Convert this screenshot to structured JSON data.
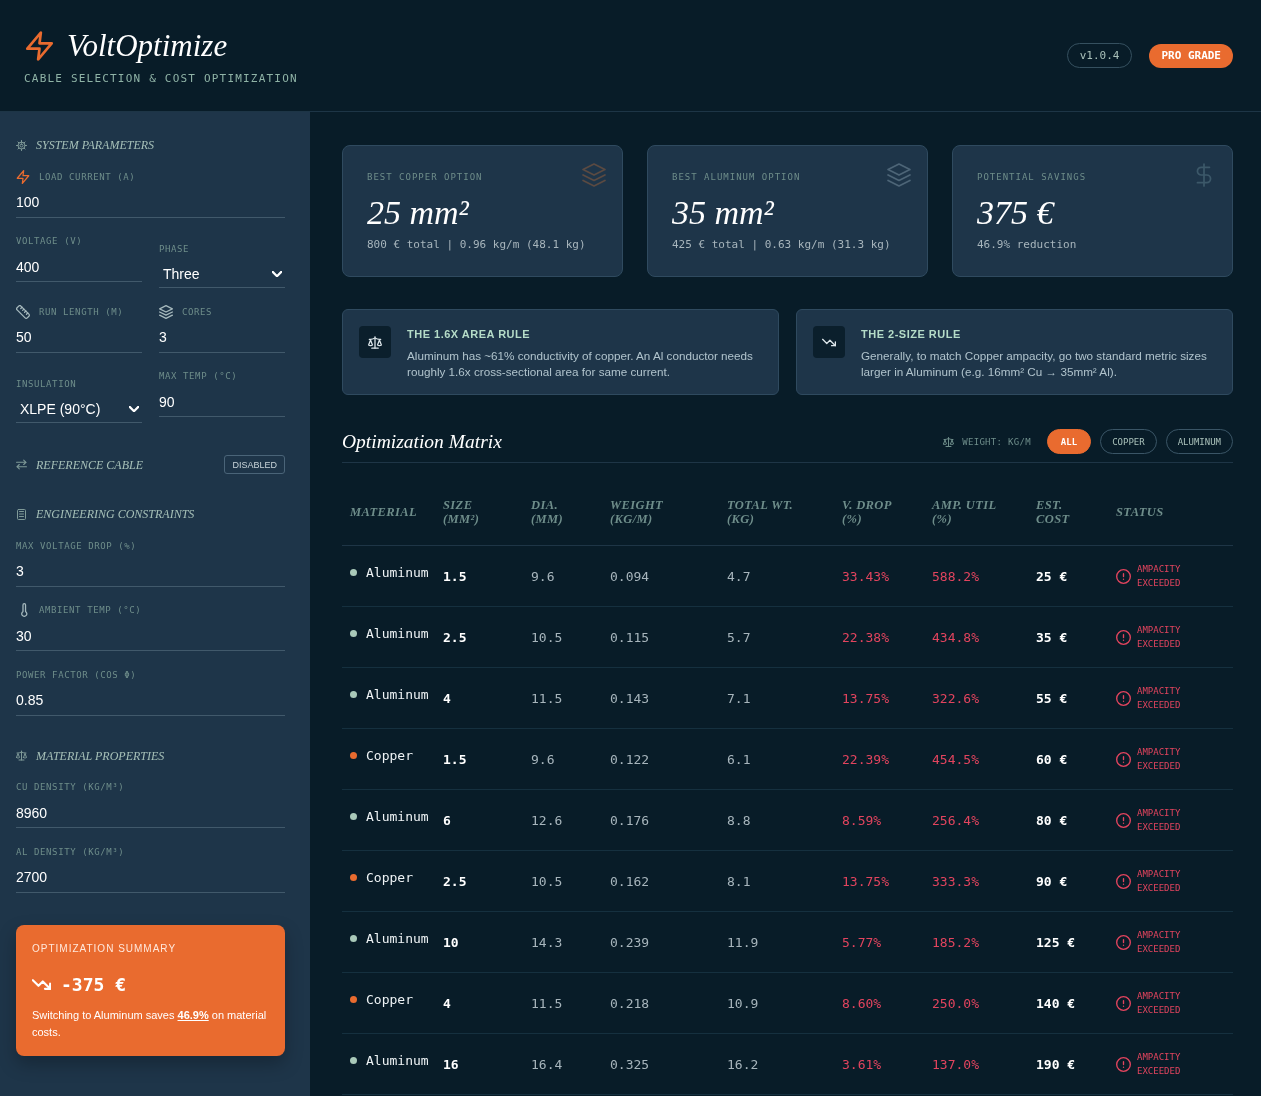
{
  "header": {
    "title": "VoltOptimize",
    "subtitle": "CABLE SELECTION & COST OPTIMIZATION",
    "version": "v1.0.4",
    "badge": "PRO GRADE"
  },
  "sidebar": {
    "sections": [
      {
        "kind": "fields",
        "title": "SYSTEM PARAMETERS",
        "rows": [
          [
            {
              "kind": "input",
              "label": "LOAD CURRENT (A)",
              "value": "100"
            }
          ],
          [
            {
              "kind": "input",
              "label": "VOLTAGE (V)",
              "value": "400"
            },
            {
              "kind": "select",
              "label": "PHASE",
              "value": "Three"
            }
          ],
          [
            {
              "kind": "input",
              "label": "RUN LENGTH (M)",
              "value": "50"
            },
            {
              "kind": "input",
              "label": "CORES",
              "value": "3"
            }
          ],
          [
            {
              "kind": "select",
              "label": "INSULATION",
              "value": "XLPE (90°C)"
            },
            {
              "kind": "input",
              "label": "MAX TEMP (°C)",
              "value": "90"
            }
          ]
        ]
      },
      {
        "kind": "toggle",
        "title": "REFERENCE CABLE",
        "badge": "DISABLED"
      },
      {
        "kind": "fields",
        "title": "ENGINEERING CONSTRAINTS",
        "rows": [
          [
            {
              "kind": "input",
              "label": "MAX VOLTAGE DROP (%)",
              "value": "3"
            }
          ],
          [
            {
              "kind": "input",
              "label": "AMBIENT TEMP (°C)",
              "value": "30"
            }
          ],
          [
            {
              "kind": "input",
              "label": "POWER FACTOR (COS Φ)",
              "value": "0.85"
            }
          ]
        ]
      },
      {
        "kind": "fields",
        "title": "MATERIAL PROPERTIES",
        "rows": [
          [
            {
              "kind": "input",
              "label": "CU DENSITY (KG/M³)",
              "value": "8960"
            }
          ],
          [
            {
              "kind": "input",
              "label": "AL DENSITY (KG/M³)",
              "value": "2700"
            }
          ]
        ]
      }
    ],
    "summary": {
      "label": "OPTIMIZATION SUMMARY",
      "value": "-375 €",
      "text": "Switching to Aluminum saves **46.9%** on material costs."
    }
  },
  "stats": [
    {
      "label": "BEST COPPER OPTION",
      "value": "25 mm²",
      "detail": "800 € total | 0.96 kg/m (48.1 kg)",
      "color": "#5a4a42"
    },
    {
      "label": "BEST ALUMINUM OPTION",
      "value": "35 mm²",
      "detail": "425 € total | 0.63 kg/m (31.3 kg)",
      "color": "#4d6577"
    },
    {
      "label": "POTENTIAL SAVINGS",
      "value": "375 €",
      "detail": "46.9% reduction",
      "color": "#3c5869"
    }
  ],
  "rules": [
    {
      "title": "THE 1.6X AREA RULE",
      "text": "Aluminum has ~61% conductivity of copper. An Al conductor needs roughly 1.6x cross-sectional area for same current."
    },
    {
      "title": "THE 2-SIZE RULE",
      "text": "Generally, to match Copper ampacity, go two standard metric sizes larger in Aluminum (e.g. 16mm² Cu → 35mm² Al)."
    }
  ],
  "matrix": {
    "title": "Optimization Matrix",
    "unit_label": "WEIGHT: KG/M",
    "filters": [
      {
        "label": "ALL",
        "selected": true
      },
      {
        "label": "COPPER",
        "selected": false
      },
      {
        "label": "ALUMINUM",
        "selected": false
      }
    ],
    "columns": [
      "MATERIAL",
      "SIZE (MM²)",
      "DIA. (MM)",
      "WEIGHT (KG/M)",
      "TOTAL WT. (KG)",
      "V. DROP (%)",
      "AMP. UTIL (%)",
      "EST. COST",
      "STATUS"
    ],
    "rows": [
      {
        "material": "Aluminum",
        "color": "#a9c9b9",
        "size": "1.5",
        "diameter": "9.6",
        "weight": "0.094",
        "total_weight": "4.7",
        "voltage_drop": "33.43%",
        "amp_util": "588.2%",
        "cost": "25 €",
        "over_limit": true,
        "status": {
          "kind": "error",
          "text": "AMPACITY EXCEEDED"
        }
      },
      {
        "material": "Aluminum",
        "color": "#a9c9b9",
        "size": "2.5",
        "diameter": "10.5",
        "weight": "0.115",
        "total_weight": "5.7",
        "voltage_drop": "22.38%",
        "amp_util": "434.8%",
        "cost": "35 €",
        "over_limit": true,
        "status": {
          "kind": "error",
          "text": "AMPACITY EXCEEDED"
        }
      },
      {
        "material": "Aluminum",
        "color": "#a9c9b9",
        "size": "4",
        "diameter": "11.5",
        "weight": "0.143",
        "total_weight": "7.1",
        "voltage_drop": "13.75%",
        "amp_util": "322.6%",
        "cost": "55 €",
        "over_limit": true,
        "status": {
          "kind": "error",
          "text": "AMPACITY EXCEEDED"
        }
      },
      {
        "material": "Copper",
        "color": "#e96b2f",
        "size": "1.5",
        "diameter": "9.6",
        "weight": "0.122",
        "total_weight": "6.1",
        "voltage_drop": "22.39%",
        "amp_util": "454.5%",
        "cost": "60 €",
        "over_limit": true,
        "status": {
          "kind": "error",
          "text": "AMPACITY EXCEEDED"
        }
      },
      {
        "material": "Aluminum",
        "color": "#a9c9b9",
        "size": "6",
        "diameter": "12.6",
        "weight": "0.176",
        "total_weight": "8.8",
        "voltage_drop": "8.59%",
        "amp_util": "256.4%",
        "cost": "80 €",
        "over_limit": true,
        "status": {
          "kind": "error",
          "text": "AMPACITY EXCEEDED"
        }
      },
      {
        "material": "Copper",
        "color": "#e96b2f",
        "size": "2.5",
        "diameter": "10.5",
        "weight": "0.162",
        "total_weight": "8.1",
        "voltage_drop": "13.75%",
        "amp_util": "333.3%",
        "cost": "90 €",
        "over_limit": true,
        "status": {
          "kind": "error",
          "text": "AMPACITY EXCEEDED"
        }
      },
      {
        "material": "Aluminum",
        "color": "#a9c9b9",
        "size": "10",
        "diameter": "14.3",
        "weight": "0.239",
        "total_weight": "11.9",
        "voltage_drop": "5.77%",
        "amp_util": "185.2%",
        "cost": "125 €",
        "over_limit": true,
        "status": {
          "kind": "error",
          "text": "AMPACITY EXCEEDED"
        }
      },
      {
        "material": "Copper",
        "color": "#e96b2f",
        "size": "4",
        "diameter": "11.5",
        "weight": "0.218",
        "total_weight": "10.9",
        "voltage_drop": "8.60%",
        "amp_util": "250.0%",
        "cost": "140 €",
        "over_limit": true,
        "status": {
          "kind": "error",
          "text": "AMPACITY EXCEEDED"
        }
      },
      {
        "material": "Aluminum",
        "color": "#a9c9b9",
        "size": "16",
        "diameter": "16.4",
        "weight": "0.325",
        "total_weight": "16.2",
        "voltage_drop": "3.61%",
        "amp_util": "137.0%",
        "cost": "190 €",
        "over_limit": true,
        "status": {
          "kind": "error",
          "text": "AMPACITY EXCEEDED"
        }
      }
    ]
  }
}
